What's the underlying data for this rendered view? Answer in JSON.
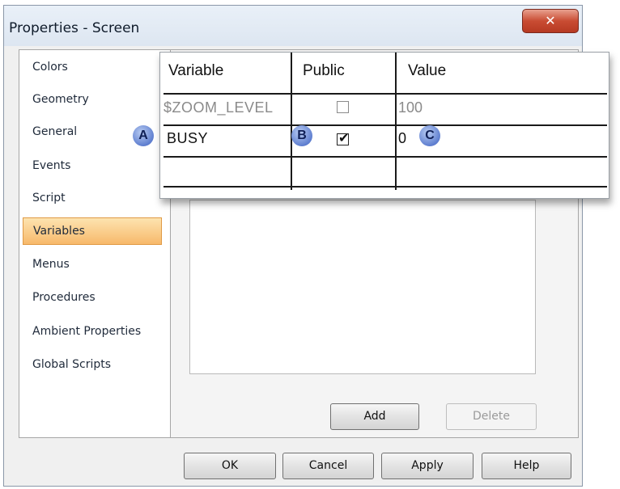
{
  "window": {
    "title": "Properties - Screen",
    "close_glyph": "✕"
  },
  "nav": {
    "items": [
      {
        "label": "Colors"
      },
      {
        "label": "Geometry"
      },
      {
        "label": "General"
      },
      {
        "label": "Events"
      },
      {
        "label": "Script"
      },
      {
        "label": "Variables",
        "selected": true
      },
      {
        "label": "Menus"
      },
      {
        "label": "Procedures"
      },
      {
        "label": "Ambient Properties"
      },
      {
        "label": "Global Scripts"
      }
    ]
  },
  "variables_table": {
    "columns": [
      "Variable",
      "Public",
      "Value"
    ],
    "rows": [
      {
        "variable": "$ZOOM_LEVEL",
        "public": false,
        "value": "100",
        "dimmed": true
      },
      {
        "variable": "BUSY",
        "public": true,
        "value": "0",
        "dimmed": false
      },
      {
        "variable": "",
        "public": null,
        "value": "",
        "dimmed": false
      }
    ]
  },
  "callouts": {
    "a": "A",
    "b": "B",
    "c": "C"
  },
  "buttons": {
    "add": "Add",
    "delete": "Delete",
    "ok": "OK",
    "cancel": "Cancel",
    "apply": "Apply",
    "help": "Help"
  },
  "colors": {
    "selected_item": "#f7b96b",
    "callout": "#5f7fd0",
    "close_button": "#c94c33"
  }
}
